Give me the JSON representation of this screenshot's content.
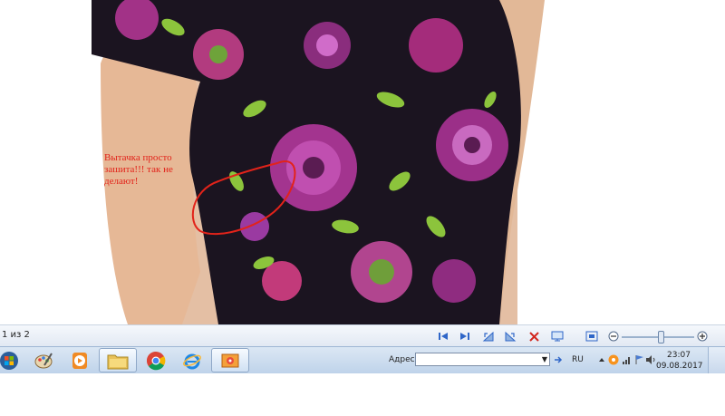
{
  "annotation": {
    "text": "Вытачка просто зашита!!! так не делают!"
  },
  "viewer": {
    "page_count": "1 из 2",
    "icons": [
      "first-page-icon",
      "next-page-icon",
      "rotate-left-icon",
      "rotate-right-icon",
      "delete-icon",
      "slideshow-icon",
      "fit-window-icon",
      "zoom-out-icon",
      "zoom-slider",
      "zoom-in-icon"
    ]
  },
  "taskbar": {
    "apps": [
      "start-orb",
      "paint-icon",
      "media-player-icon",
      "file-explorer-icon",
      "chrome-icon",
      "internet-explorer-icon",
      "image-viewer-icon"
    ],
    "address_label": "Адрес",
    "address_value": "",
    "language": "RU",
    "clock_time": "23:07",
    "clock_date": "09.08.2017"
  },
  "colors": {
    "annotation": "#e2231a",
    "accent": "#2f66c8"
  }
}
